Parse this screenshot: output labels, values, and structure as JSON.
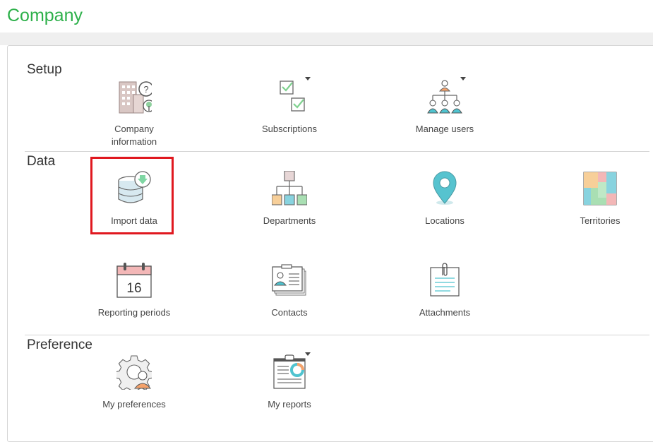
{
  "page": {
    "title": "Company"
  },
  "sections": [
    {
      "title": "Setup",
      "items": [
        {
          "label": "Company information",
          "icon": "building-info-icon"
        },
        {
          "label": "Subscriptions",
          "icon": "checklist-icon",
          "has_dropdown": true
        },
        {
          "label": "Manage users",
          "icon": "users-hierarchy-icon",
          "has_dropdown": true
        }
      ]
    },
    {
      "title": "Data",
      "items": [
        {
          "label": "Import data",
          "icon": "database-download-icon",
          "highlighted": true
        },
        {
          "label": "Departments",
          "icon": "org-chart-icon"
        },
        {
          "label": "Locations",
          "icon": "map-pin-icon"
        },
        {
          "label": "Territories",
          "icon": "territory-map-icon"
        },
        {
          "label": "Reporting periods",
          "icon": "calendar-icon",
          "calendar_day": "16"
        },
        {
          "label": "Contacts",
          "icon": "contact-cards-icon"
        },
        {
          "label": "Attachments",
          "icon": "paperclip-document-icon"
        }
      ]
    },
    {
      "title": "Preference",
      "items": [
        {
          "label": "My preferences",
          "icon": "gear-user-icon"
        },
        {
          "label": "My reports",
          "icon": "clipboard-report-icon",
          "has_dropdown": true
        }
      ]
    }
  ],
  "colors": {
    "title_green": "#2db04a",
    "highlight_red": "#e0181f",
    "accent_teal": "#4fc3cf",
    "accent_orange": "#f5a26b"
  }
}
